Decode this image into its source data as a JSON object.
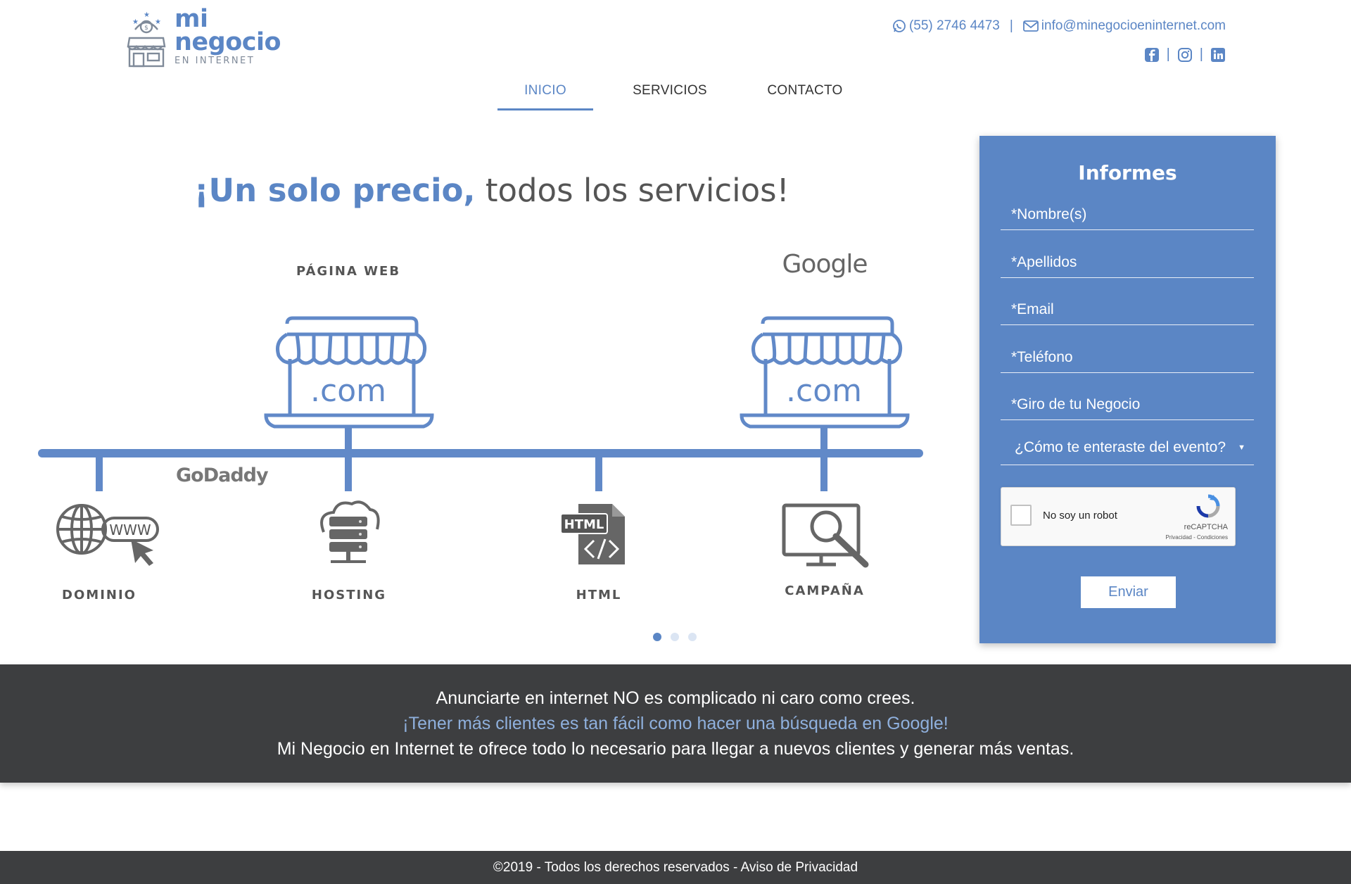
{
  "brand": {
    "line1": "mi",
    "line2": "negocio",
    "line3": "EN INTERNET",
    "accent_color": "#5b86c5",
    "dark_color": "#3d3e40"
  },
  "contact": {
    "phone": "(55) 2746 4473",
    "separator": "|",
    "email": "info@minegocioeninternet.com",
    "phone_icon": "whatsapp-icon",
    "email_icon": "envelope-icon"
  },
  "social": {
    "icons": [
      "facebook-icon",
      "instagram-icon",
      "linkedin-icon"
    ],
    "separator": "|"
  },
  "nav": {
    "items": [
      {
        "label": "INICIO",
        "active": true
      },
      {
        "label": "SERVICIOS",
        "active": false
      },
      {
        "label": "CONTACTO",
        "active": false
      }
    ]
  },
  "hero": {
    "title_bold": "¡Un solo precio,",
    "title_rest": " todos los servicios!",
    "labels": {
      "web": "PÁGINA WEB",
      "dominio": "DOMINIO",
      "hosting": "HOSTING",
      "html": "HTML",
      "campana": "CAMPAÑA"
    },
    "store_text": ".com",
    "html_badge": "HTML",
    "www_text": "WWW",
    "brands": {
      "google": "Google",
      "godaddy": "GoDaddy"
    },
    "slides": {
      "count": 3,
      "active": 0
    }
  },
  "form": {
    "title": "Informes",
    "fields": {
      "nombre": "*Nombre(s)",
      "apellidos": "*Apellidos",
      "email": "*Email",
      "telefono": "*Teléfono",
      "giro": "*Giro de tu Negocio"
    },
    "select_value": "¿Cómo te enteraste del evento?",
    "captcha": {
      "label": "No soy un robot",
      "brand": "reCAPTCHA",
      "links": "Privacidad - Condiciones"
    },
    "submit": "Enviar"
  },
  "band": {
    "line1": "Anunciarte en internet NO es complicado ni caro como crees.",
    "line2": "¡Tener más clientes es tan fácil como hacer una búsqueda en Google!",
    "line3": "Mi Negocio en Internet te ofrece todo lo necesario para llegar a nuevos clientes y generar más ventas."
  },
  "footer": {
    "copyright": "©2019 - Todos los derechos reservados - ",
    "privacy": "Aviso de Privacidad"
  }
}
